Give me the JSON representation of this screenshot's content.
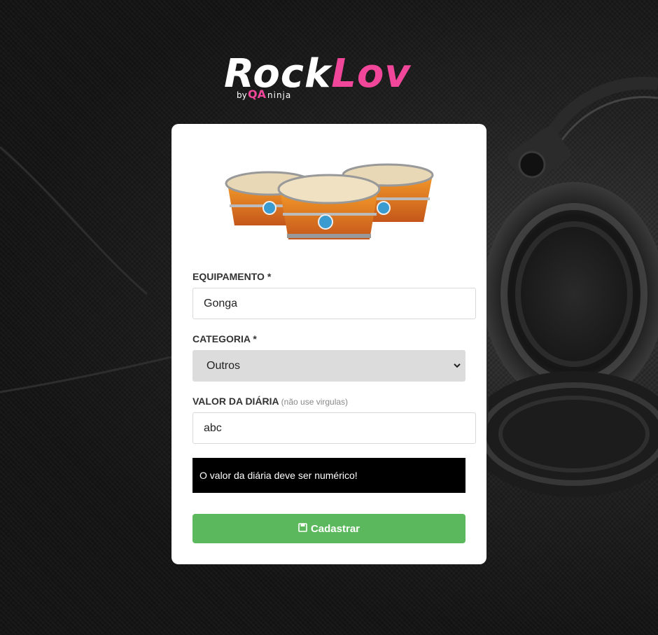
{
  "brand": {
    "name_part1": "Rock",
    "name_part2": "Lov",
    "by": "by",
    "qa": "QA",
    "ninja": "ninja",
    "accent_color": "#f0479a"
  },
  "form": {
    "equipment": {
      "label": "EQUIPAMENTO *",
      "value": "Gonga"
    },
    "category": {
      "label": "CATEGORIA *",
      "selected": "Outros"
    },
    "daily_value": {
      "label": "VALOR DA DIÁRIA",
      "hint": "(não use virgulas)",
      "value": "abc"
    },
    "error_message": "O valor da diária deve ser numérico!",
    "submit_label": "Cadastrar",
    "submit_icon": "save-icon",
    "submit_color": "#5cb85c"
  }
}
